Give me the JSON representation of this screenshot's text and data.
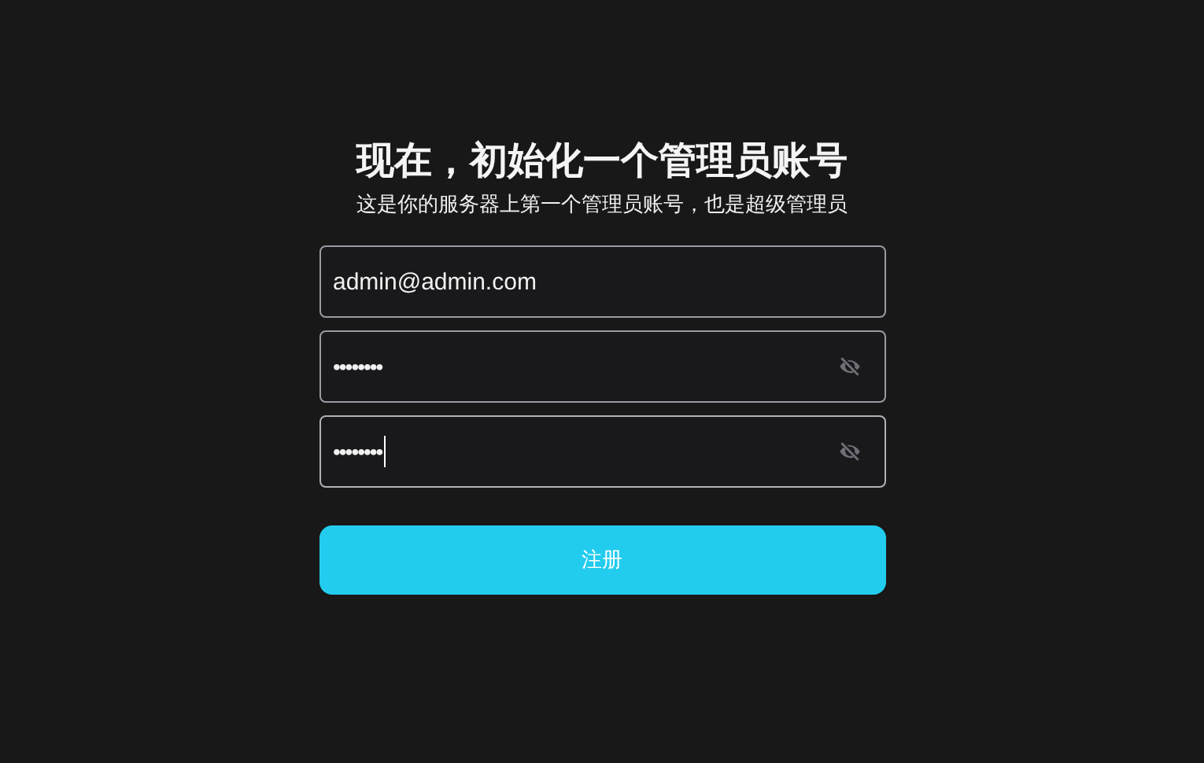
{
  "heading": {
    "title": "现在，初始化一个管理员账号",
    "subtitle": "这是你的服务器上第一个管理员账号，也是超级管理员"
  },
  "fields": [
    {
      "kind": "email",
      "value": "admin@admin.com",
      "focused": false
    },
    {
      "kind": "password",
      "value": "••••••••",
      "focused": false
    },
    {
      "kind": "password",
      "value": "••••••••",
      "focused": true
    }
  ],
  "submit": {
    "label": "注册"
  }
}
